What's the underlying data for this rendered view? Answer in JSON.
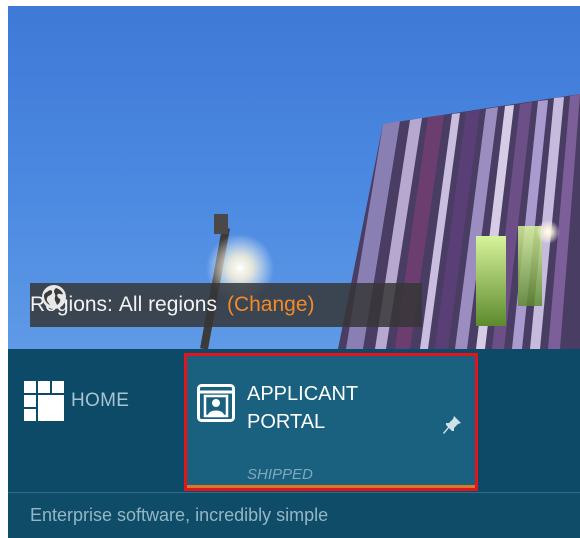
{
  "region": {
    "label": "Regions:",
    "value": "All regions",
    "change_link": "(Change)"
  },
  "nav": {
    "home_label": "HOME",
    "tile": {
      "title": "APPLICANT\nPORTAL",
      "status": "SHIPPED"
    }
  },
  "footer": {
    "tagline": "Enterprise software, incredibly simple"
  },
  "icons": [
    "globe-icon",
    "home-grid-icon",
    "portal-card-icon",
    "pin-icon"
  ],
  "colors": {
    "nav_bg": "#0d4a67",
    "tile_bg": "#1a6180",
    "tile_highlight_border": "#e3141a",
    "tile_accent": "#d57b28",
    "change_link": "#f28a2a"
  }
}
